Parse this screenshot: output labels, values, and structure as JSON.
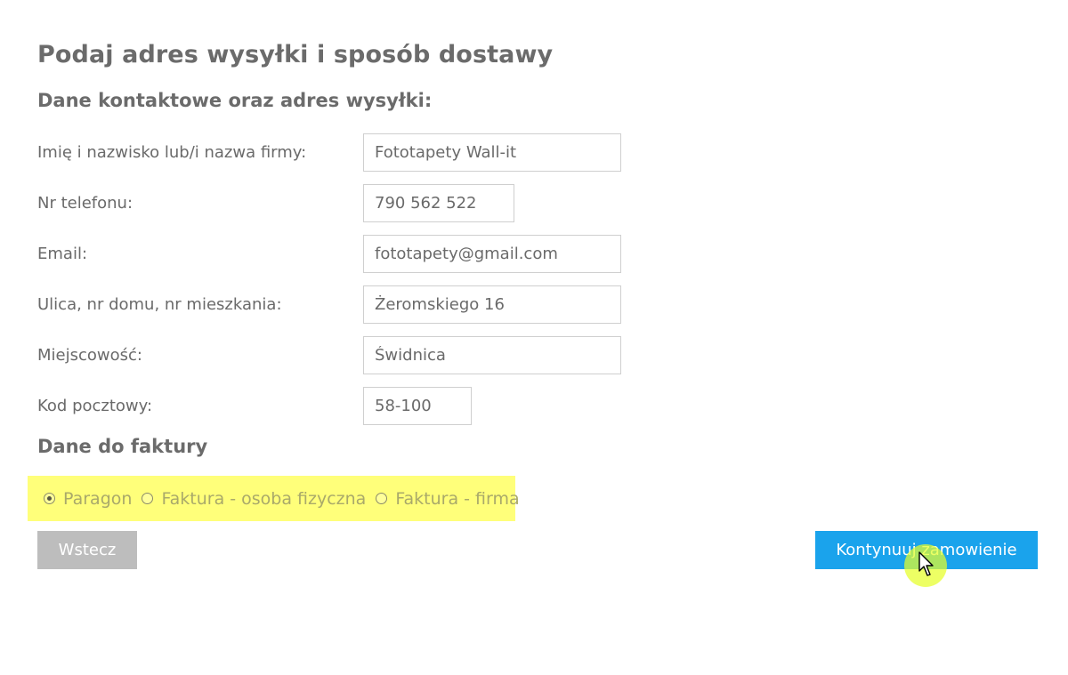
{
  "page": {
    "title": "Podaj adres wysyłki i sposób dostawy"
  },
  "contact": {
    "section_title": "Dane kontaktowe oraz adres wysyłki:",
    "fields": [
      {
        "label": "Imię i nazwisko lub/i nazwa firmy:",
        "value": "Fototapety Wall-it"
      },
      {
        "label": "Nr telefonu:",
        "value": "790 562 522"
      },
      {
        "label": "Email:",
        "value": "fototapety@gmail.com"
      },
      {
        "label": "Ulica, nr domu, nr mieszkania:",
        "value": "Żeromskiego 16"
      },
      {
        "label": "Miejscowość:",
        "value": "Świdnica"
      },
      {
        "label": "Kod pocztowy:",
        "value": "58-100"
      }
    ]
  },
  "invoice": {
    "section_title": "Dane do faktury",
    "options": [
      {
        "label": "Paragon",
        "selected": true
      },
      {
        "label": "Faktura - osoba fizyczna",
        "selected": false
      },
      {
        "label": "Faktura - firma",
        "selected": false
      }
    ],
    "highlight_color": "#ffff7a"
  },
  "actions": {
    "back_label": "Wstecz",
    "continue_label": "Kontynuuj zamowienie",
    "continue_color": "#1aa3ec",
    "back_color": "#bdbdbd"
  },
  "cursor": {
    "icon": "arrow-pointer-icon",
    "highlight": "cursor-highlight"
  }
}
